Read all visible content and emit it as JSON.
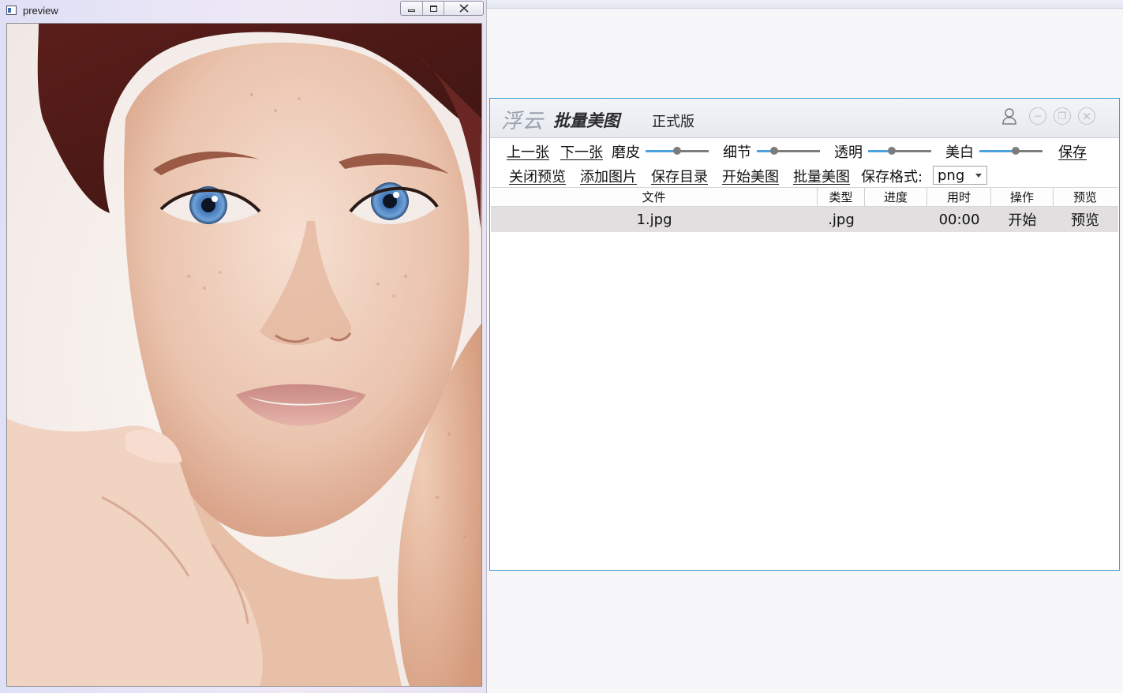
{
  "preview_window": {
    "title": "preview",
    "minimize": "",
    "maximize": "",
    "close": "☒"
  },
  "app": {
    "brand_cloud": "浮云",
    "brand_name": "批量美图",
    "edition": "正式版",
    "header_icons": {
      "user": "user-icon",
      "minimize": "−",
      "maximize": "❐",
      "close": "×"
    },
    "toolbar": {
      "prev_link": "上一张",
      "next_link": "下一张",
      "smooth_label": "磨皮",
      "detail_label": "细节",
      "opacity_label": "透明",
      "whiten_label": "美白",
      "save_link": "保存",
      "close_preview_link": "关闭预览",
      "add_image_link": "添加图片",
      "save_dir_link": "保存目录",
      "start_beautify_link": "开始美图",
      "batch_beautify_link": "批量美图",
      "format_label": "保存格式:",
      "format_value": "png"
    },
    "sliders": {
      "smooth": 0.5,
      "detail": 0.27,
      "opacity": 0.38,
      "whiten": 0.58
    },
    "slider_colors": {
      "filled": "#4aa3de",
      "rest": "#7d7d7d",
      "knob": "#7c7c7c"
    },
    "table": {
      "headers": [
        "文件",
        "类型",
        "进度",
        "用时",
        "操作",
        "预览"
      ],
      "rows": [
        {
          "file": "1.jpg",
          "type": ".jpg",
          "progress": "",
          "time": "00:00",
          "action": "开始",
          "preview": "预览"
        }
      ]
    }
  }
}
